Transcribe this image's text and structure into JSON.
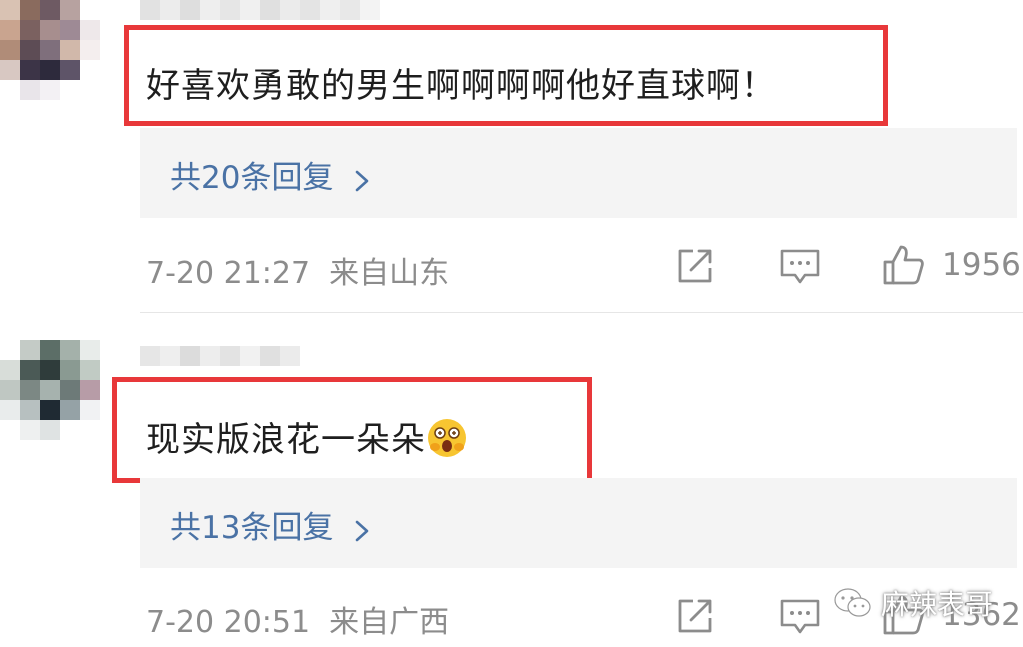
{
  "comments": [
    {
      "text": "好喜欢勇敢的男生啊啊啊啊他好直球啊！",
      "replies": "共20条回复",
      "time": "7-20 21:27",
      "location": "来自山东",
      "likes": "1956"
    },
    {
      "text": "现实版浪花一朵朵",
      "emoji": "shocked-face-emoji",
      "replies": "共13条回复",
      "time": "7-20 20:51",
      "location": "来自广西",
      "likes": "1362"
    }
  ],
  "watermark": "麻辣表哥",
  "colors": {
    "highlight": "#e8383a",
    "link": "#4a72a5",
    "meta": "#8c8c8c",
    "panel": "#f4f4f4"
  }
}
